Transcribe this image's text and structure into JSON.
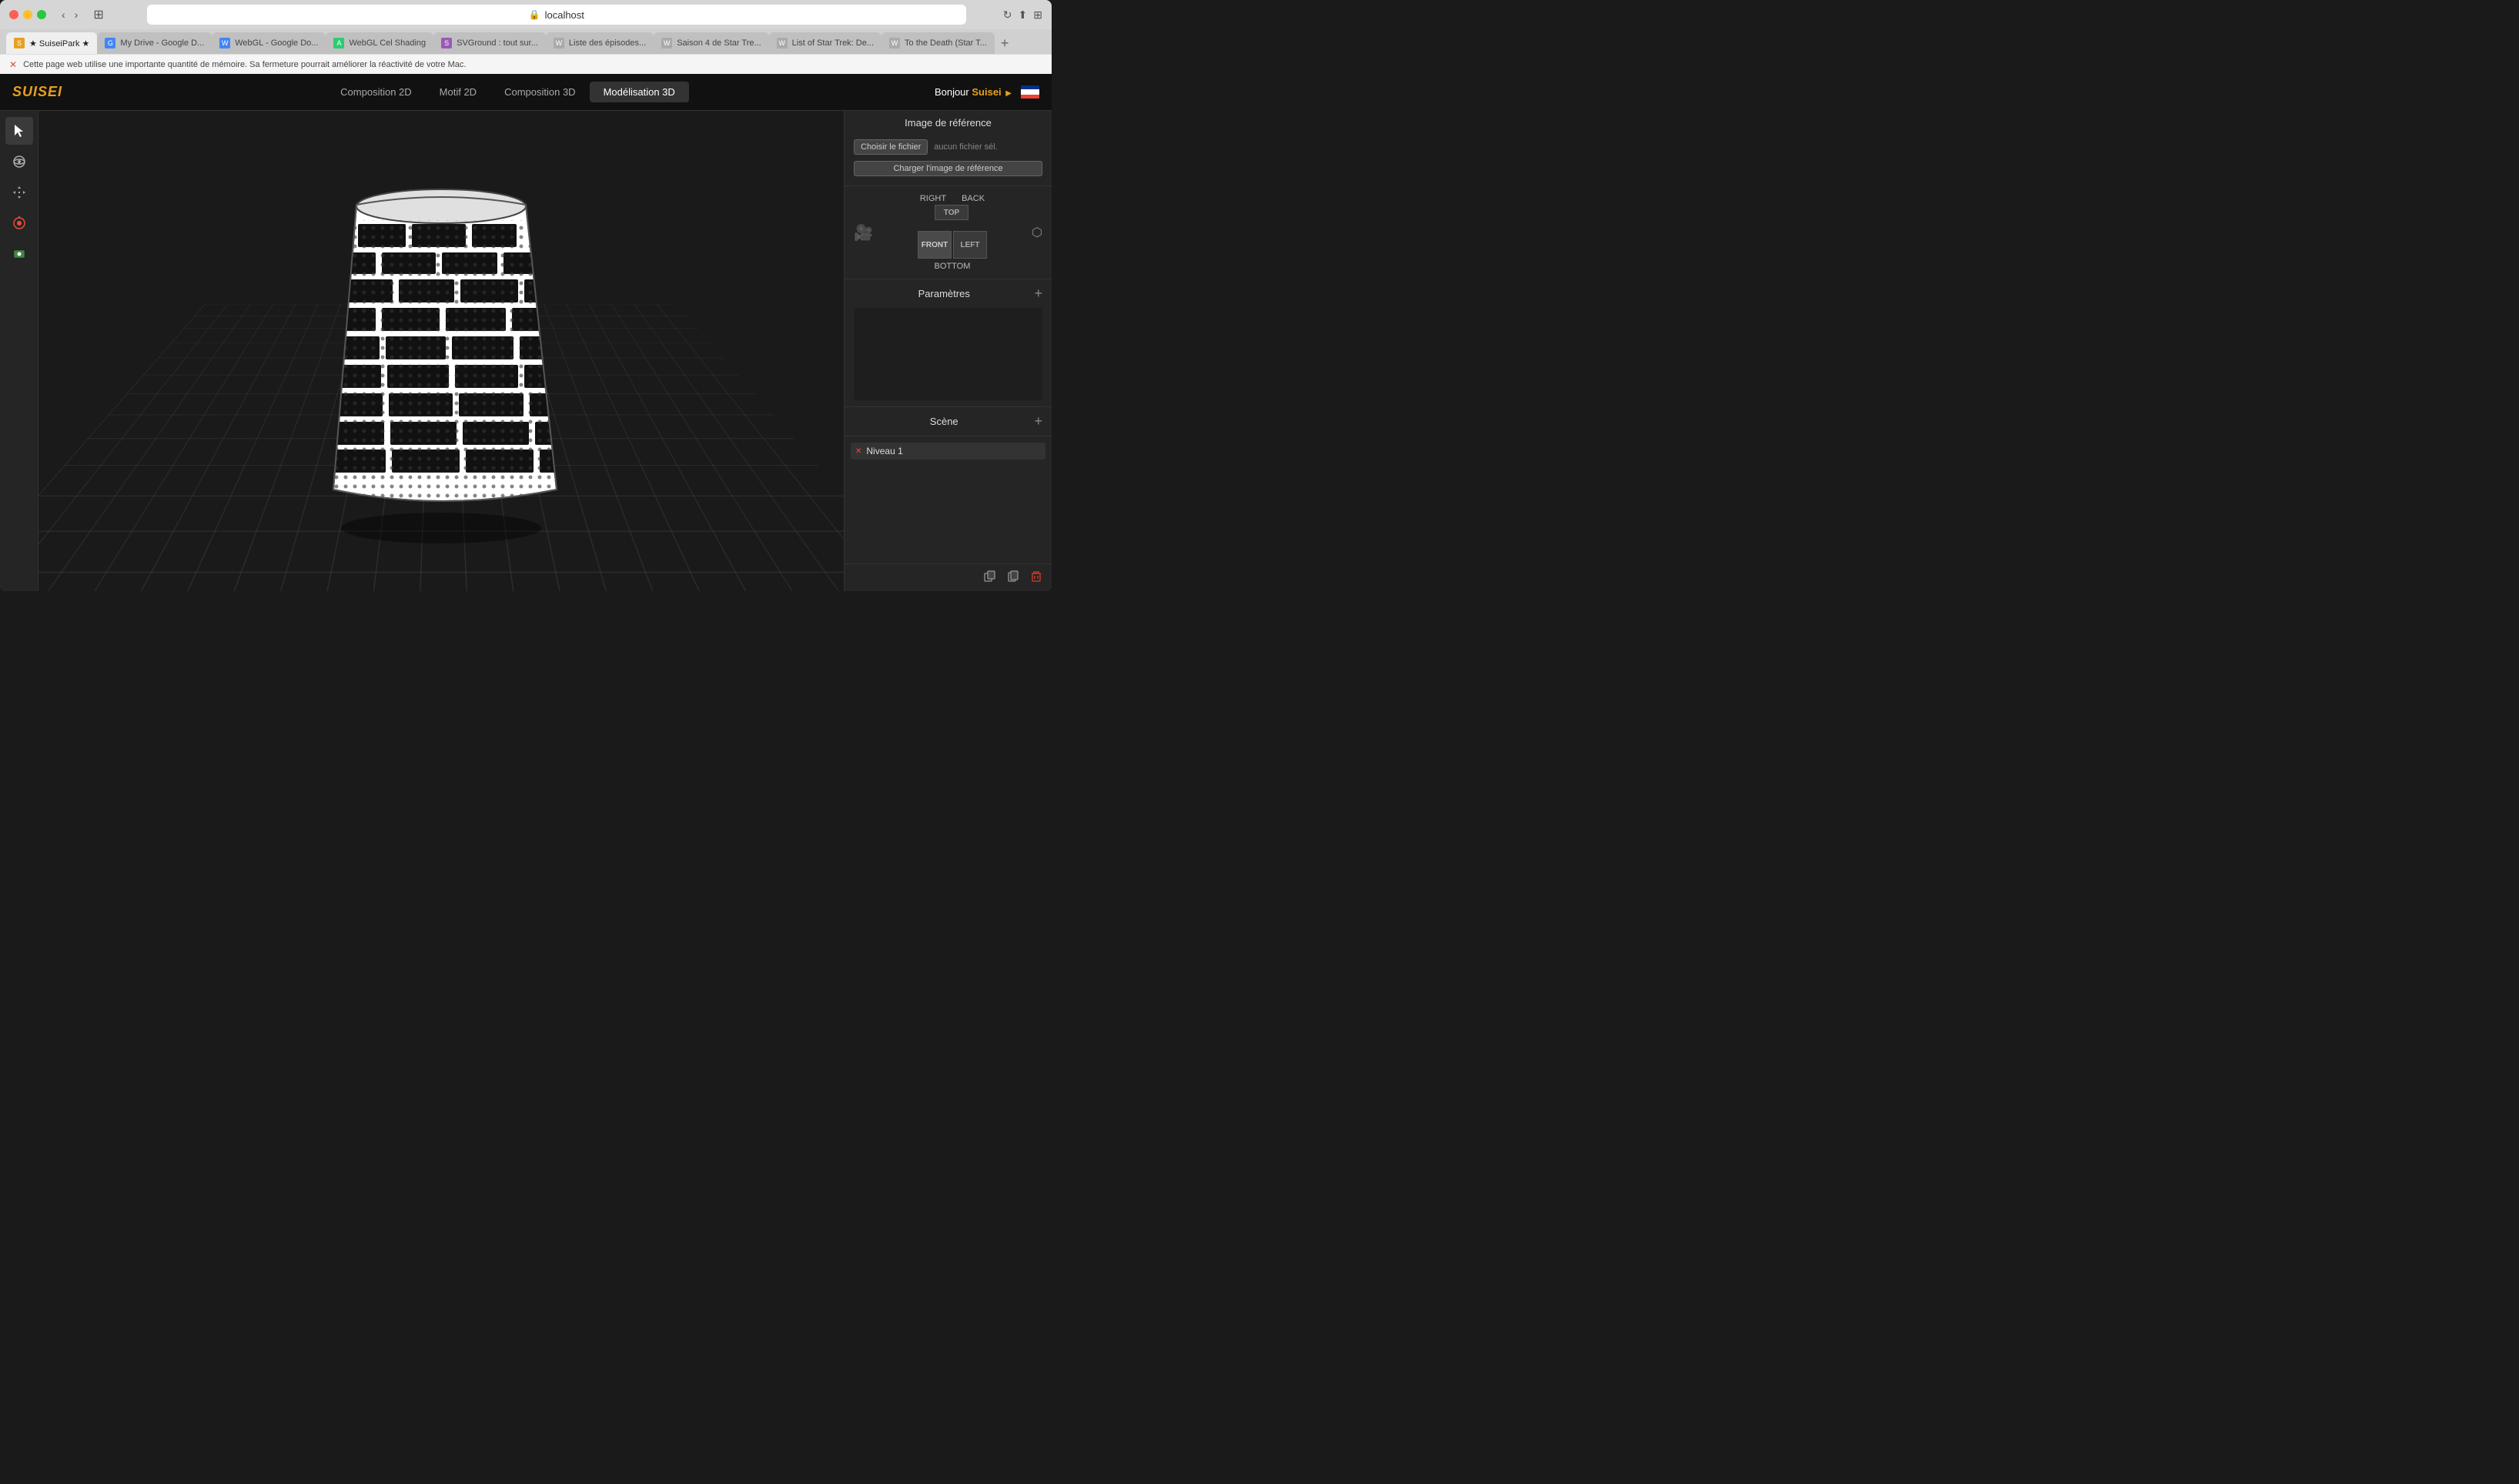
{
  "browser": {
    "address": "localhost",
    "reload_icon": "↻",
    "back_icon": "‹",
    "forward_icon": "›",
    "tabs": [
      {
        "id": "suiseipark",
        "label": "★ SuiseiPark ★",
        "active": true,
        "favicon_color": "#e8a020",
        "favicon_text": "S"
      },
      {
        "id": "google-drive",
        "label": "My Drive - Google D...",
        "active": false,
        "favicon_color": "#4285f4",
        "favicon_text": "G"
      },
      {
        "id": "webgl-google",
        "label": "WebGL - Google Do...",
        "active": false,
        "favicon_color": "#4285f4",
        "favicon_text": "W"
      },
      {
        "id": "webgl-cel",
        "label": "WebGL Cel Shading",
        "active": false,
        "favicon_color": "#2ecc71",
        "favicon_text": "A"
      },
      {
        "id": "svground",
        "label": "SVGround : tout sur...",
        "active": false,
        "favicon_color": "#9b59b6",
        "favicon_text": "S"
      },
      {
        "id": "liste-episodes",
        "label": "Liste des épisodes...",
        "active": false,
        "favicon_color": "#aaa",
        "favicon_text": "W"
      },
      {
        "id": "saison4",
        "label": "Saison 4 de Star Tre...",
        "active": false,
        "favicon_color": "#aaa",
        "favicon_text": "W"
      },
      {
        "id": "list-star-trek",
        "label": "List of Star Trek: De...",
        "active": false,
        "favicon_color": "#aaa",
        "favicon_text": "W"
      },
      {
        "id": "to-the-death",
        "label": "To the Death (Star T...",
        "active": false,
        "favicon_color": "#aaa",
        "favicon_text": "W"
      }
    ],
    "info_bar": {
      "text": "Cette page web utilise une importante quantité de mémoire. Sa fermeture pourrait améliorer la réactivité de votre Mac.",
      "icon": "✕"
    }
  },
  "app": {
    "logo": "SUISEI",
    "nav_items": [
      {
        "id": "composition-2d",
        "label": "Composition 2D",
        "active": false
      },
      {
        "id": "motif-2d",
        "label": "Motif 2D",
        "active": false
      },
      {
        "id": "composition-3d",
        "label": "Composition 3D",
        "active": false
      },
      {
        "id": "modelisation-3d",
        "label": "Modélisation 3D",
        "active": true
      }
    ],
    "header_right": {
      "greeting": "Bonjour",
      "username": "Suisei",
      "play_icon": "▶"
    }
  },
  "tools": [
    {
      "id": "select",
      "icon": "cursor",
      "label": "Select tool"
    },
    {
      "id": "orbit",
      "icon": "orbit",
      "label": "Orbit tool"
    },
    {
      "id": "move",
      "icon": "move",
      "label": "Move tool"
    },
    {
      "id": "rotate",
      "icon": "rotate",
      "label": "Rotate tool"
    },
    {
      "id": "layer",
      "icon": "layer",
      "label": "Layer tool"
    }
  ],
  "right_panel": {
    "reference_image": {
      "title": "Image de référence",
      "choose_label": "Choisir le fichier",
      "no_file_label": "aucun fichier sél.",
      "load_label": "Charger l'image de référence"
    },
    "camera": {
      "cube_labels": {
        "right": "RIGHT",
        "back": "BACK",
        "front": "FRONT",
        "left": "LEFT",
        "top": "TOP",
        "bottom": "BOTTOM"
      }
    },
    "parametres": {
      "title": "Paramètres",
      "add_icon": "+"
    },
    "scene": {
      "title": "Scène",
      "add_icon": "+",
      "items": [
        {
          "id": "niveau1",
          "label": "Niveau 1",
          "icon": "✕"
        }
      ],
      "footer_buttons": [
        {
          "id": "duplicate",
          "icon": "⧉",
          "label": "Duplicate"
        },
        {
          "id": "copy",
          "icon": "📋",
          "label": "Copy"
        },
        {
          "id": "delete",
          "icon": "🗑",
          "label": "Delete"
        }
      ]
    }
  }
}
